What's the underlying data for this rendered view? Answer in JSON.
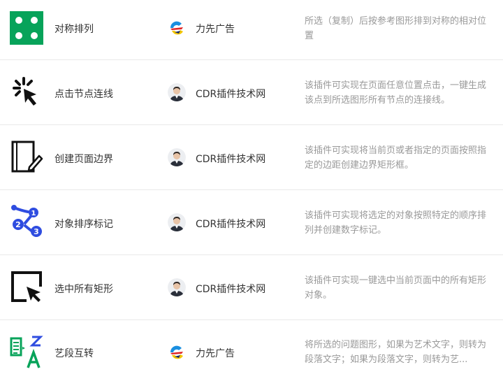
{
  "colors": {
    "text_primary": "#333333",
    "text_secondary": "#999999",
    "divider": "#e9e9e9",
    "icon_green": "#07a35a",
    "icon_blue": "#2f4de0",
    "icon_black": "#111111"
  },
  "plugins": [
    {
      "icon": "symmetric-arrange-icon",
      "name": "对称排列",
      "author": "力先广告",
      "author_avatar": "lixian-logo",
      "description": "所选（复制）后按参考图形排到对称的相对位置"
    },
    {
      "icon": "click-connect-icon",
      "name": "点击节点连线",
      "author": "CDR插件技术网",
      "author_avatar": "person-avatar",
      "description": "该插件可实现在页面任意位置点击，一键生成该点到所选图形所有节点的连接线。"
    },
    {
      "icon": "page-border-icon",
      "name": "创建页面边界",
      "author": "CDR插件技术网",
      "author_avatar": "person-avatar",
      "description": "该插件可实现将当前页或者指定的页面按照指定的边距创建边界矩形框。"
    },
    {
      "icon": "numbered-sort-icon",
      "name": "对象排序标记",
      "author": "CDR插件技术网",
      "author_avatar": "person-avatar",
      "description": "该插件可实现将选定的对象按照特定的顺序排列并创建数字标记。"
    },
    {
      "icon": "select-rectangles-icon",
      "name": "选中所有矩形",
      "author": "CDR插件技术网",
      "author_avatar": "person-avatar",
      "description": "该插件可实现一键选中当前页面中的所有矩形对象。"
    },
    {
      "icon": "text-convert-icon",
      "name": "艺段互转",
      "author": "力先广告",
      "author_avatar": "lixian-logo",
      "description": "将所选的问题图形，如果为艺术文字，则转为段落文字；如果为段落文字，则转为艺..."
    }
  ]
}
